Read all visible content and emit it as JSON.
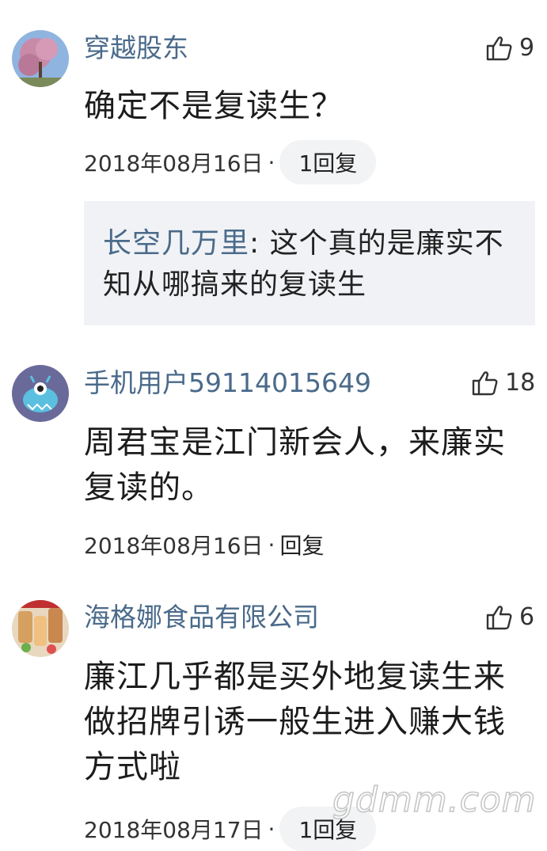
{
  "comments": [
    {
      "username": "穿越股东",
      "likes": "9",
      "content": "确定不是复读生？",
      "date": "2018年08月16日",
      "separator": "·",
      "reply_label": "1回复",
      "replies": [
        {
          "author": "长空几万里",
          "colon": ":",
          "text": " 这个真的是廉实不知从哪搞来的复读生"
        }
      ]
    },
    {
      "username": "手机用户59114015649",
      "likes": "18",
      "content": "周君宝是江门新会人，来廉实复读的。",
      "date": "2018年08月16日",
      "separator": "·",
      "reply_label": "回复"
    },
    {
      "username": "海格娜食品有限公司",
      "likes": "6",
      "content": "廉江几乎都是买外地复读生来做招牌引诱一般生进入赚大钱方式啦",
      "date": "2018年08月17日",
      "separator": "·",
      "reply_label": "1回复"
    }
  ],
  "watermark": "gdmm.com",
  "icons": {
    "like": "thumbs-up-icon"
  },
  "colors": {
    "username": "#4a6a8a",
    "reply_bg": "#f0f2f5",
    "pill_bg": "#f2f3f5"
  }
}
